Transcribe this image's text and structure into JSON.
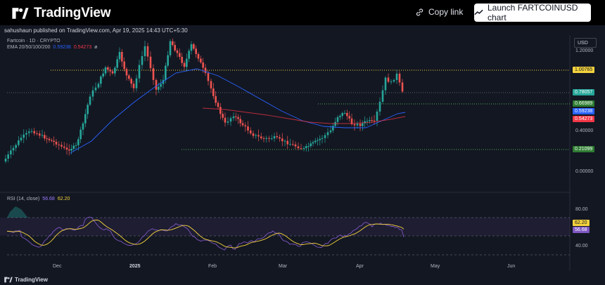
{
  "header": {
    "brand": "TradingView",
    "copy_link_label": "Copy link",
    "launch_button_label": "Launch FARTCOINUSD chart"
  },
  "publication": {
    "byline": "sahushaun published on TradingView.com, Apr 19, 2025 14:43 UTC+5:30"
  },
  "symbol_legend": {
    "title": "Fartcoin · 1D · CRYPTO",
    "ema_label": "EMA 20/50/100/200",
    "ema_50": "0.59238",
    "ema_100": "0.54273",
    "ema_extra": "ø"
  },
  "rsi_legend": {
    "label": "RSI (14, close)",
    "value": "56.68",
    "ma_value": "62.20"
  },
  "price_axis": {
    "currency": "USD",
    "ticks": [
      "1.20000",
      "0.40000",
      "0.00000"
    ],
    "rsi_ticks": [
      "80.00",
      "40.00"
    ]
  },
  "price_tags": {
    "resistance": "1.00765",
    "last": "0.78057",
    "support_mid": "0.66989",
    "ema_50": "0.59238",
    "ema_100": "0.54273",
    "support_low": "0.21099",
    "rsi": "62.20",
    "rsi_ma": "56.68"
  },
  "time_axis": {
    "labels": [
      "Dec",
      "2025",
      "Feb",
      "Mar",
      "Apr",
      "May",
      "Jun"
    ]
  },
  "footer": {
    "brand": "TradingView"
  },
  "colors": {
    "up": "#26a69a",
    "down": "#ef5350",
    "ema_blue": "#2962ff",
    "ema_red": "#f23645",
    "rsi_line": "#7e57c2",
    "rsi_ma": "#f5d33d",
    "resistance_line": "#f5d33d",
    "support_line": "#4caf50"
  }
}
